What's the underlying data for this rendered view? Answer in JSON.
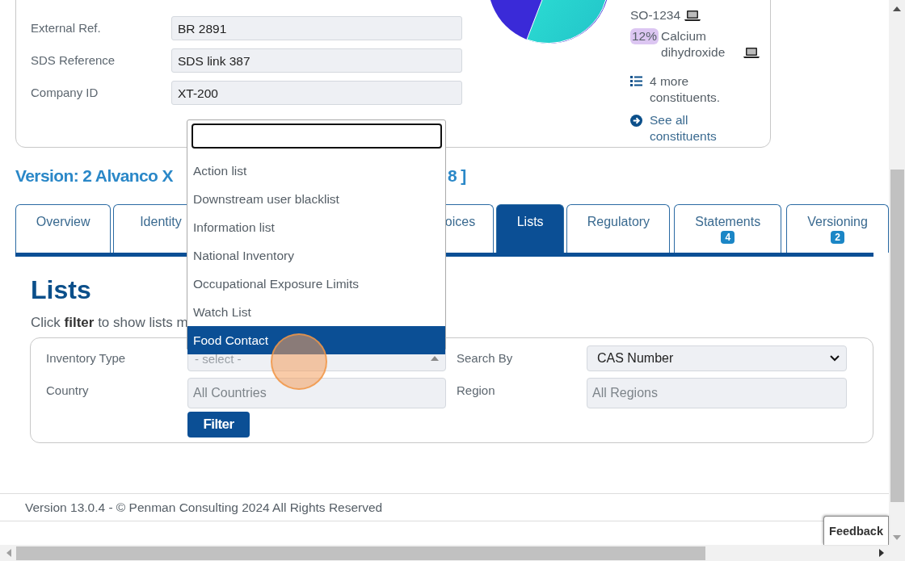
{
  "details": {
    "fields": [
      {
        "label": "External Ref.",
        "value": "BR 2891"
      },
      {
        "label": "SDS Reference",
        "value": "SDS link 387"
      },
      {
        "label": "Company ID",
        "value": "XT-200"
      }
    ],
    "constituents": [
      {
        "name": "SO-1234"
      },
      {
        "percent": "12%",
        "name": "Calcium dihydroxide"
      }
    ],
    "more": "4 more constituents.",
    "see_all": "See all constituents"
  },
  "version_heading": {
    "start": "Version: 2 Alvanco X",
    "end": "8 ]"
  },
  "tabs": [
    {
      "label": "Overview",
      "selected": false
    },
    {
      "label": "Identity",
      "selected": false
    },
    {
      "label": "oices",
      "selected": false,
      "kind": "partial"
    },
    {
      "label": "Lists",
      "selected": true
    },
    {
      "label": "Regulatory",
      "selected": false
    },
    {
      "label": "Statements",
      "selected": false,
      "badge": "4"
    },
    {
      "label": "Versioning",
      "selected": false,
      "badge": "2"
    }
  ],
  "section_title": "Lists",
  "hint": "Click **filter** to show lists m",
  "filter": {
    "inventory_type": {
      "label": "Inventory Type",
      "placeholder": "- select -",
      "expanded": true
    },
    "search_by": {
      "label": "Search By",
      "value": "CAS Number"
    },
    "country": {
      "label": "Country",
      "placeholder": "All Countries"
    },
    "region": {
      "label": "Region",
      "placeholder": "All Regions"
    },
    "button": "Filter"
  },
  "dropdown": {
    "options": [
      {
        "label": "Action list",
        "selected": false
      },
      {
        "label": "Downstream user blacklist",
        "selected": false
      },
      {
        "label": "Information list",
        "selected": false
      },
      {
        "label": "National Inventory",
        "selected": false
      },
      {
        "label": "Occupational Exposure Limits",
        "selected": false
      },
      {
        "label": "Watch List",
        "selected": false
      },
      {
        "label": "Food Contact",
        "selected": true
      }
    ]
  },
  "footer": "Version 13.0.4 - © Penman Consulting 2024 All Rights Reserved",
  "feedback_button": "Feedback"
}
